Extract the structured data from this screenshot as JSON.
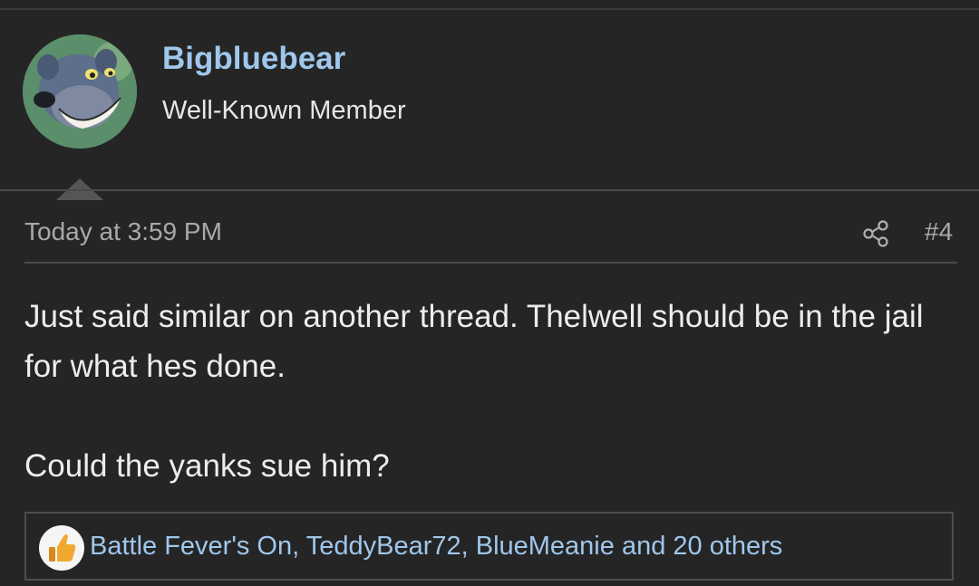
{
  "user": {
    "name": "Bigbluebear",
    "title": "Well-Known Member",
    "avatar_icon": "baloo-bear-avatar"
  },
  "post": {
    "date": "Today at 3:59 PM",
    "number": "#4",
    "share_icon": "share-icon",
    "paragraphs": [
      "Just said similar on another thread. Thelwell should be in the jail for what hes done.",
      "Could the yanks sue him?"
    ]
  },
  "reactions": {
    "icon": "thumbs-up-icon",
    "text": "Battle Fever's On, TeddyBear72, BlueMeanie and 20 others"
  },
  "colors": {
    "background": "#252525",
    "link": "#9fc7ec",
    "text": "#ededed",
    "muted": "#a9a9a9"
  }
}
